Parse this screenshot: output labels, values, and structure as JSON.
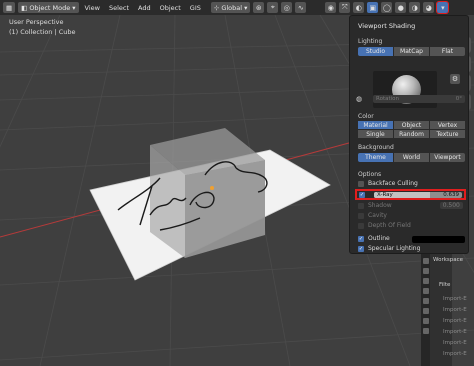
{
  "topbar": {
    "mode": "Object Mode",
    "menus": [
      "View",
      "Select",
      "Add",
      "Object",
      "GIS"
    ],
    "transform": "Global"
  },
  "viewport": {
    "line1": "User Perspective",
    "line2": "(1) Collection | Cube"
  },
  "popup": {
    "title": "Viewport Shading",
    "lighting_label": "Lighting",
    "lighting_opts": [
      "Studio",
      "MatCap",
      "Flat"
    ],
    "rotation_label": "Rotation",
    "rotation_value": "0°",
    "color_label": "Color",
    "color_opts": [
      "Material",
      "Object",
      "Vertex",
      "Single",
      "Random",
      "Texture"
    ],
    "background_label": "Background",
    "background_opts": [
      "Theme",
      "World",
      "Viewport"
    ],
    "options_label": "Options",
    "backface": "Backface Culling",
    "xray": "X-Ray",
    "xray_value": "0.639",
    "xray_fraction": 0.639,
    "shadow": "Shadow",
    "shadow_value": "0.500",
    "cavity": "Cavity",
    "dof": "Depth Of Field",
    "outline": "Outline",
    "specular": "Specular Lighting"
  },
  "side_panel": {
    "workspace": "Workspace",
    "filter": "Filte",
    "import_items": [
      "Import-E",
      "Import-E",
      "Import-E",
      "Import-E",
      "Import-E",
      "Import-E"
    ]
  },
  "colors": {
    "accent": "#4772b3",
    "highlight": "#e01e1e"
  }
}
